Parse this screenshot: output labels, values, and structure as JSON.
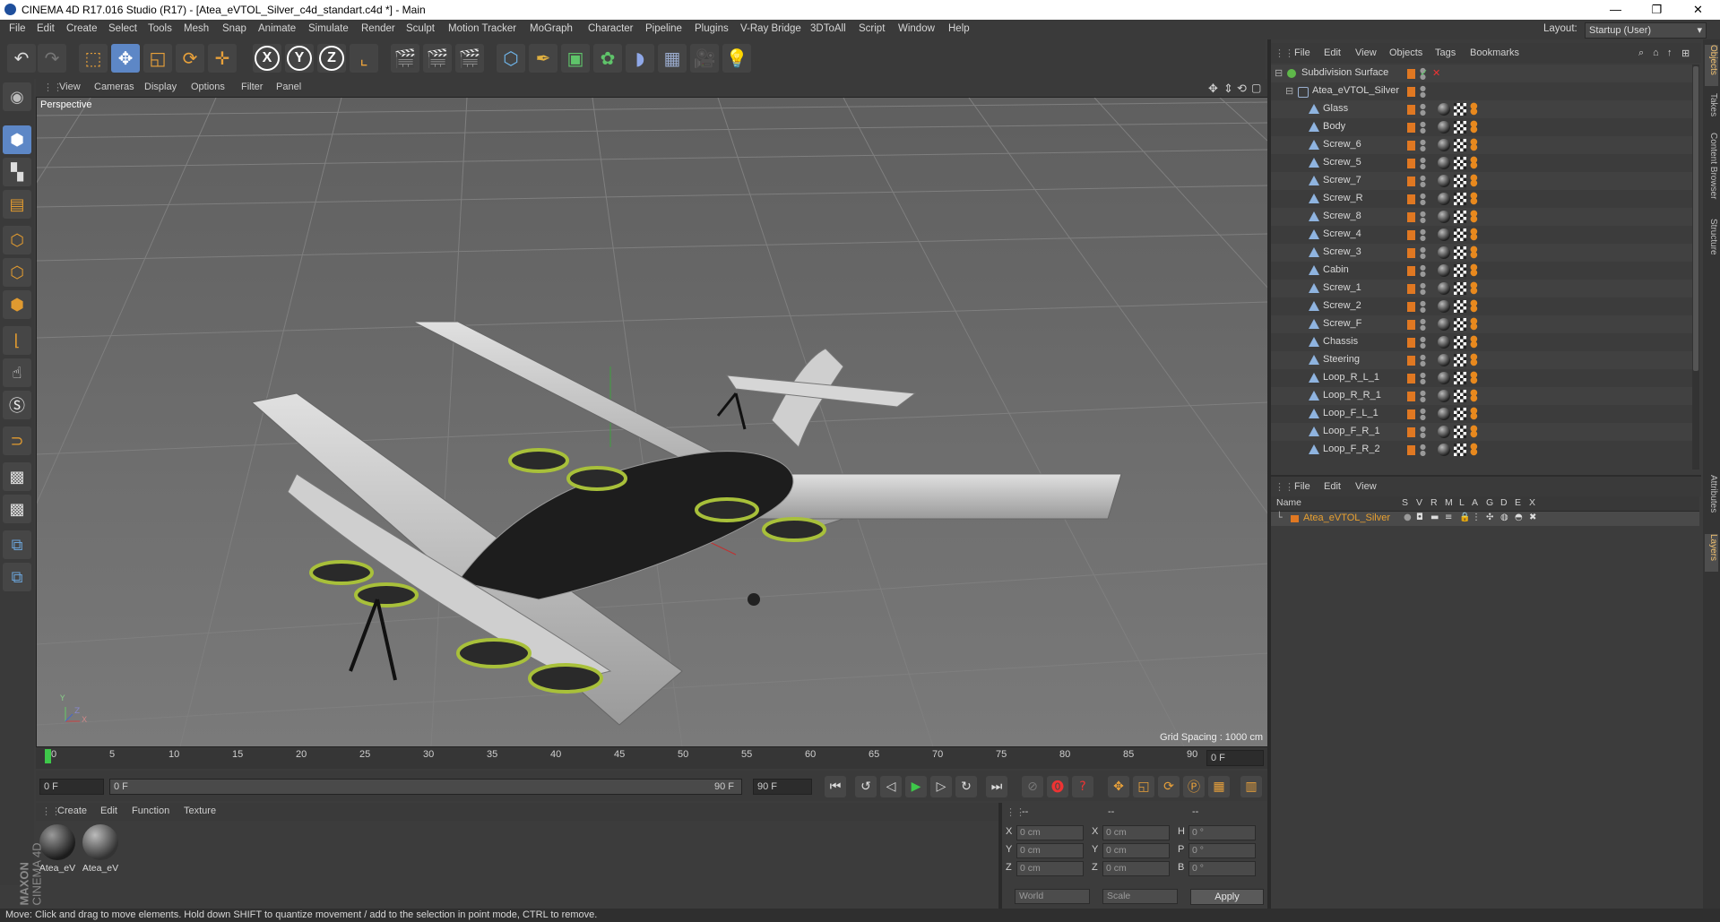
{
  "window": {
    "title": "CINEMA 4D R17.016 Studio (R17) - [Atea_eVTOL_Silver_c4d_standart.c4d *] - Main",
    "minimize": "—",
    "maximize": "❐",
    "close": "✕"
  },
  "menu": [
    "File",
    "Edit",
    "Create",
    "Select",
    "Tools",
    "Mesh",
    "Snap",
    "Animate",
    "Simulate",
    "Render",
    "Sculpt",
    "Motion Tracker",
    "MoGraph",
    "Character",
    "Pipeline",
    "Plugins",
    "V-Ray Bridge",
    "3DToAll",
    "Script",
    "Window",
    "Help"
  ],
  "layout": {
    "label": "Layout:",
    "value": "Startup (User)"
  },
  "axis_buttons": [
    "X",
    "Y",
    "Z"
  ],
  "viewport": {
    "menu": [
      "View",
      "Cameras",
      "Display",
      "Options",
      "Filter",
      "Panel"
    ],
    "label": "Perspective",
    "grid_spacing": "Grid Spacing : 1000 cm",
    "axis_x": "X",
    "axis_y": "Y",
    "axis_z": "Z"
  },
  "timeline": {
    "ticks": [
      "0",
      "5",
      "10",
      "15",
      "20",
      "25",
      "30",
      "35",
      "40",
      "45",
      "50",
      "55",
      "60",
      "65",
      "70",
      "75",
      "80",
      "85",
      "90"
    ],
    "current_frame": "0 F",
    "start_field": "0 F",
    "range_start": "0 F",
    "range_end": "90 F",
    "end_field": "90 F"
  },
  "materials": {
    "menu": [
      "Create",
      "Edit",
      "Function",
      "Texture"
    ],
    "items": [
      {
        "label": "Atea_eV"
      },
      {
        "label": "Atea_eV"
      }
    ]
  },
  "brand": {
    "line1": "MAXON",
    "line2": "CINEMA 4D"
  },
  "coordinates": {
    "header": [
      "--",
      "--",
      "--"
    ],
    "rows": [
      {
        "l1": "X",
        "v1": "0 cm",
        "l2": "X",
        "v2": "0 cm",
        "l3": "H",
        "v3": "0 °"
      },
      {
        "l1": "Y",
        "v1": "0 cm",
        "l2": "Y",
        "v2": "0 cm",
        "l3": "P",
        "v3": "0 °"
      },
      {
        "l1": "Z",
        "v1": "0 cm",
        "l2": "Z",
        "v2": "0 cm",
        "l3": "B",
        "v3": "0 °"
      }
    ],
    "mode": "World",
    "scale": "Scale",
    "apply": "Apply"
  },
  "status": "Move: Click and drag to move elements. Hold down SHIFT to quantize movement / add to the selection in point mode, CTRL to remove.",
  "object_manager": {
    "menu": [
      "File",
      "Edit",
      "View",
      "Objects",
      "Tags",
      "Bookmarks"
    ],
    "objects": [
      {
        "name": "Subdivision Surface",
        "indent": 0,
        "icon": "sub"
      },
      {
        "name": "Atea_eVTOL_Silver",
        "indent": 1,
        "icon": "null"
      },
      {
        "name": "Glass",
        "indent": 2,
        "icon": "poly"
      },
      {
        "name": "Body",
        "indent": 2,
        "icon": "poly"
      },
      {
        "name": "Screw_6",
        "indent": 2,
        "icon": "poly"
      },
      {
        "name": "Screw_5",
        "indent": 2,
        "icon": "poly"
      },
      {
        "name": "Screw_7",
        "indent": 2,
        "icon": "poly"
      },
      {
        "name": "Screw_R",
        "indent": 2,
        "icon": "poly"
      },
      {
        "name": "Screw_8",
        "indent": 2,
        "icon": "poly"
      },
      {
        "name": "Screw_4",
        "indent": 2,
        "icon": "poly"
      },
      {
        "name": "Screw_3",
        "indent": 2,
        "icon": "poly"
      },
      {
        "name": "Cabin",
        "indent": 2,
        "icon": "poly"
      },
      {
        "name": "Screw_1",
        "indent": 2,
        "icon": "poly"
      },
      {
        "name": "Screw_2",
        "indent": 2,
        "icon": "poly"
      },
      {
        "name": "Screw_F",
        "indent": 2,
        "icon": "poly"
      },
      {
        "name": "Chassis",
        "indent": 2,
        "icon": "poly"
      },
      {
        "name": "Steering",
        "indent": 2,
        "icon": "poly"
      },
      {
        "name": "Loop_R_L_1",
        "indent": 2,
        "icon": "poly"
      },
      {
        "name": "Loop_R_R_1",
        "indent": 2,
        "icon": "poly"
      },
      {
        "name": "Loop_F_L_1",
        "indent": 2,
        "icon": "poly"
      },
      {
        "name": "Loop_F_R_1",
        "indent": 2,
        "icon": "poly"
      },
      {
        "name": "Loop_F_R_2",
        "indent": 2,
        "icon": "poly"
      }
    ]
  },
  "layer_manager": {
    "menu": [
      "File",
      "Edit",
      "View"
    ],
    "columns": [
      "Name",
      "S",
      "V",
      "R",
      "M",
      "L",
      "A",
      "G",
      "D",
      "E",
      "X"
    ],
    "layers": [
      {
        "name": "Atea_eVTOL_Silver"
      }
    ]
  },
  "side_tabs": [
    "Objects",
    "Takes",
    "Content Browser",
    "Structure",
    "Attributes",
    "Layers"
  ],
  "colors": {
    "accent": "#5d87c6",
    "layer_name": "#e8a030",
    "tag_orange": "#e07822"
  }
}
